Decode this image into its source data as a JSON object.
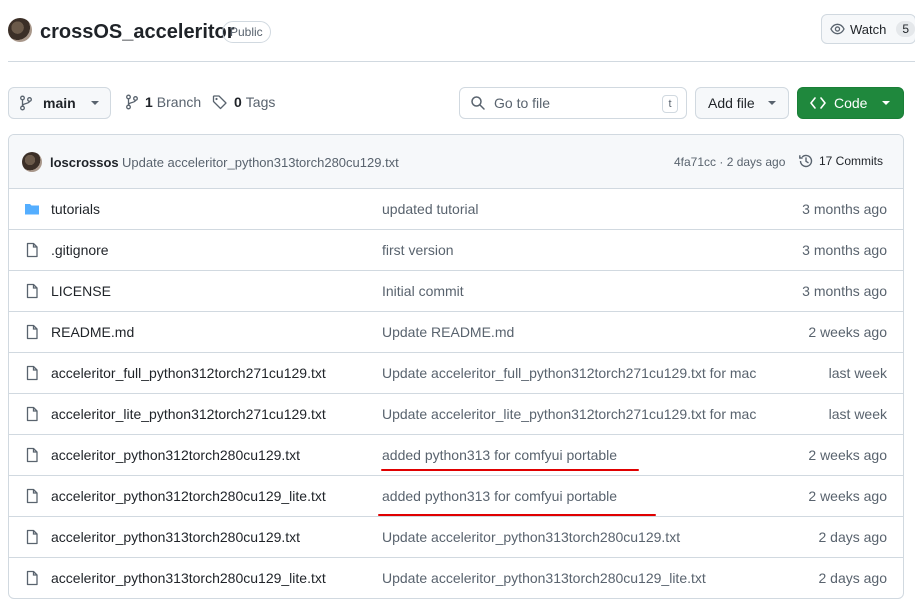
{
  "repo": {
    "name": "crossOS_acceleritor",
    "visibility": "Public",
    "watch_label": "Watch",
    "watch_count": "5"
  },
  "toolbar": {
    "branch_label": "main",
    "branch_count": "1",
    "branch_word": "Branch",
    "tag_count": "0",
    "tag_word": "Tags",
    "search_placeholder": "Go to file",
    "search_shortcut": "t",
    "add_file_label": "Add file",
    "code_label": "Code"
  },
  "latest_commit": {
    "author": "loscrossos",
    "message": "Update acceleritor_python313torch280cu129.txt",
    "hash_time": "4fa71cc · 2 days ago",
    "commits_label": "17 Commits"
  },
  "files": [
    {
      "name": "tutorials",
      "type": "folder",
      "message": "updated tutorial",
      "age": "3 months ago"
    },
    {
      "name": ".gitignore",
      "type": "file",
      "message": "first version",
      "age": "3 months ago"
    },
    {
      "name": "LICENSE",
      "type": "file",
      "message": "Initial commit",
      "age": "3 months ago"
    },
    {
      "name": "README.md",
      "type": "file",
      "message": "Update README.md",
      "age": "2 weeks ago"
    },
    {
      "name": "acceleritor_full_python312torch271cu129.txt",
      "type": "file",
      "message": "Update acceleritor_full_python312torch271cu129.txt for mac",
      "age": "last week"
    },
    {
      "name": "acceleritor_lite_python312torch271cu129.txt",
      "type": "file",
      "message": "Update acceleritor_lite_python312torch271cu129.txt for mac",
      "age": "last week"
    },
    {
      "name": "acceleritor_python312torch280cu129.txt",
      "type": "file",
      "message": "added python313 for comfyui portable",
      "age": "2 weeks ago"
    },
    {
      "name": "acceleritor_python312torch280cu129_lite.txt",
      "type": "file",
      "message": "added python313 for comfyui portable",
      "age": "2 weeks ago"
    },
    {
      "name": "acceleritor_python313torch280cu129.txt",
      "type": "file",
      "message": "Update acceleritor_python313torch280cu129.txt",
      "age": "2 days ago"
    },
    {
      "name": "acceleritor_python313torch280cu129_lite.txt",
      "type": "file",
      "message": "Update acceleritor_python313torch280cu129_lite.txt",
      "age": "2 days ago"
    }
  ],
  "colors": {
    "accent_green": "#1f883d",
    "folder_blue": "#54aeff",
    "annotation_red": "#e00000"
  }
}
